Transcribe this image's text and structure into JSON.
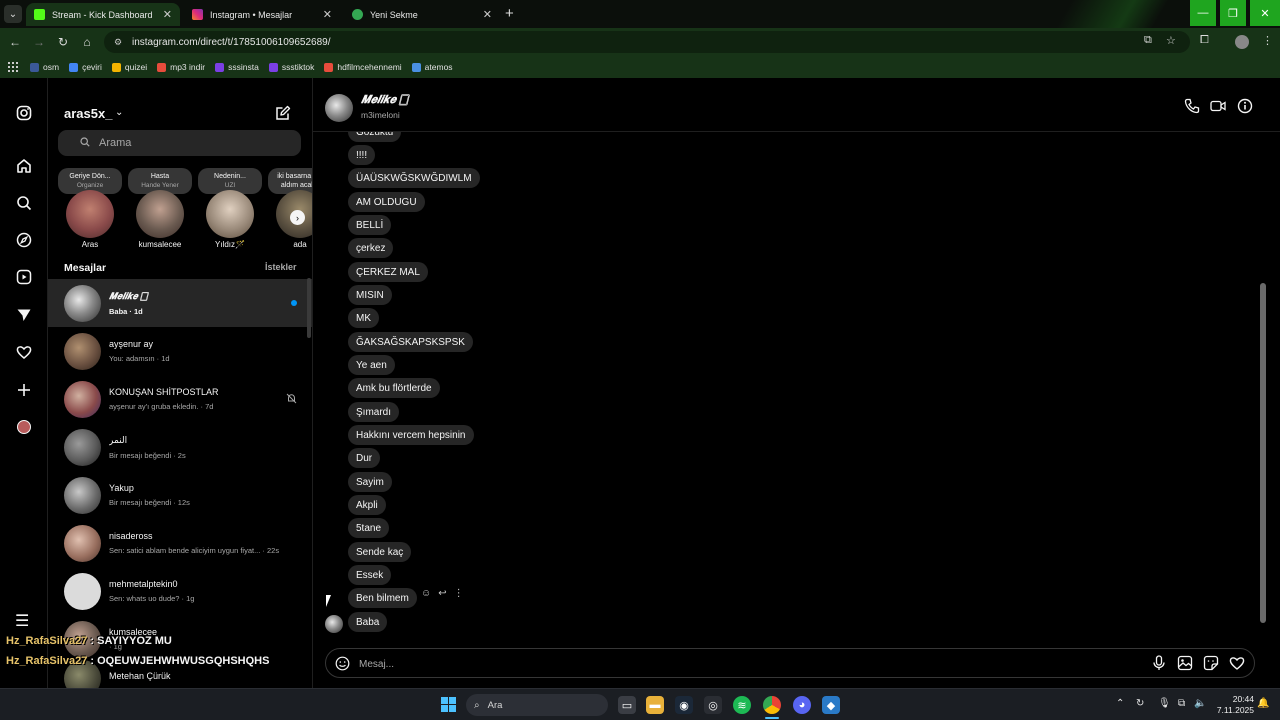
{
  "browser": {
    "tabs": [
      {
        "label": "Stream - Kick Dashboard",
        "active": true,
        "color": "#53fc18"
      },
      {
        "label": "Instagram • Mesajlar",
        "active": false,
        "color": "#e1306c"
      },
      {
        "label": "Yeni Sekme",
        "active": false,
        "color": "#34a853"
      }
    ],
    "url": "instagram.com/direct/t/17851006109652689/",
    "bookmarks": [
      {
        "label": "osm",
        "color": "#3b5998"
      },
      {
        "label": "çeviri",
        "color": "#4285f4"
      },
      {
        "label": "quizei",
        "color": "#f4b400"
      },
      {
        "label": "mp3 indir",
        "color": "#e74c3c"
      },
      {
        "label": "sssinsta",
        "color": "#7b3fe4"
      },
      {
        "label": "ssstiktok",
        "color": "#7b3fe4"
      },
      {
        "label": "hdfilmcehennemi",
        "color": "#e74c3c"
      },
      {
        "label": "atemos",
        "color": "#4a90e2"
      }
    ]
  },
  "sidebar": {
    "username": "aras5x_",
    "search_placeholder": "Arama",
    "notes": [
      {
        "text": "Geriye Dön...",
        "sub": "Organize",
        "name": "Aras",
        "color": "#8a4a4a"
      },
      {
        "text": "Hasta",
        "sub": "Hande Yener",
        "name": "kumsalecee",
        "color": "#6a5a50"
      },
      {
        "text": "Nedenin...",
        "sub": "UZI",
        "name": "Yıldız🪄",
        "color": "#9a8a7a"
      },
      {
        "text": "iki basarna not aldım acaba",
        "sub": "",
        "name": "ada",
        "color": "#5a5040"
      }
    ],
    "section_title": "Mesajlar",
    "requests_label": "İstekler",
    "conversations": [
      {
        "name": "𝑴𝒆𝒍𝒊𝒌𝒆 🀆",
        "preview": "Baba · 1d",
        "active": true,
        "unread": true,
        "color": "#7a7a7a"
      },
      {
        "name": "ayşenur ay",
        "preview": "You: adamsın · 1d",
        "active": false,
        "unread": false,
        "color": "#6a5040"
      },
      {
        "name": "KONUŞAN SHİTPOSTLAR",
        "preview": "ayşenur ay'ı gruba ekledin. · 7d",
        "active": false,
        "unread": false,
        "muted": true,
        "color": "#8a4a4a"
      },
      {
        "name": "النمر",
        "preview": "Bir mesajı beğendi · 2s",
        "active": false,
        "unread": false,
        "color": "#5a5a5a"
      },
      {
        "name": "Yakup",
        "preview": "Bir mesajı beğendi · 12s",
        "active": false,
        "unread": false,
        "color": "#6a6a6a"
      },
      {
        "name": "nisadeross",
        "preview": "Sen: satici ablam bende aliciyim uygun fiyat... · 22s",
        "active": false,
        "unread": false,
        "color": "#9a7060"
      },
      {
        "name": "mehmetalptekin0",
        "preview": "Sen: whats uo dude? · 1g",
        "active": false,
        "unread": false,
        "color": "#dbdbdb"
      },
      {
        "name": "kumsalecee",
        "preview": "· 1g",
        "active": false,
        "unread": false,
        "color": "#6a5a50"
      },
      {
        "name": "Metehan Çürük",
        "preview": "",
        "active": false,
        "unread": false,
        "color": "#4a4a3a"
      }
    ],
    "overlay_lines": [
      {
        "nick": "Hz_RafaSilva27",
        "text": " : SAYIYYOZ MU"
      },
      {
        "nick": "Hz_RafaSilva27",
        "text": " : OQEUWJEHWHWUSGQHSHQHS"
      }
    ]
  },
  "chat": {
    "name": "𝑴𝒆𝒍𝒊𝒌𝒆 🀆",
    "username": "m3imeloni",
    "messages": [
      "Gözüktü",
      "!!!!",
      "ÜAÜSKWĞSKWĞDIWLM",
      "AM OLDUGU",
      "BELLİ",
      "çerkez",
      "ÇERKEZ MAL",
      "MISIN",
      "MK",
      "ĞAKSAĞSKAPSKSPSK",
      "Ye aen",
      "Amk bu flörtlerde",
      "Şımardı",
      "Hakkını vercem hepsinin",
      "Dur",
      "Sayim",
      "Akpli",
      "5tane",
      "Sende kaç",
      "Essek",
      "Ben bilmem",
      "Baba"
    ],
    "composer_placeholder": "Mesaj..."
  },
  "taskbar": {
    "search_label": "Ara",
    "time": "20:44",
    "date": "7.11.2025"
  }
}
